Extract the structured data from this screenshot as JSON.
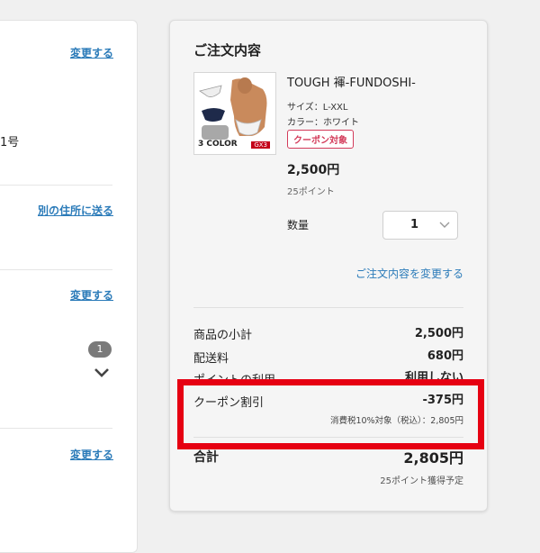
{
  "left": {
    "change_link_1": "変更する",
    "address_fragment": "1号",
    "ship_other_link": "別の住所に送る",
    "change_link_2": "変更する",
    "item_count_badge": "1",
    "change_link_3": "変更する"
  },
  "order": {
    "title": "ご注文内容",
    "product": {
      "name": "TOUGH 褌-FUNDOSHI-",
      "size": "サイズ：L-XXL",
      "color": "カラー：ホワイト",
      "coupon_tag": "クーポン対象",
      "price": "2,500円",
      "points": "25ポイント",
      "image_label_color": "3 COLOR",
      "image_label_brand": "GX3"
    },
    "quantity": {
      "label": "数量",
      "value": "1"
    },
    "change_order_link": "ご注文内容を変更する",
    "summary": {
      "subtotal_label": "商品の小計",
      "subtotal_value": "2,500円",
      "shipping_label": "配送料",
      "shipping_value": "680円",
      "points_use_label": "ポイントの利用",
      "points_use_value": "利用しない",
      "coupon_label": "クーポン割引",
      "coupon_value": "-375円",
      "tax_note": "消費税10%対象（税込）：2,805円",
      "total_label": "合計",
      "total_value": "2,805円",
      "earn_note": "25ポイント獲得予定"
    }
  },
  "colors": {
    "link": "#2b7bb9",
    "coupon_tag": "#d33b5a",
    "highlight": "#e60012"
  }
}
